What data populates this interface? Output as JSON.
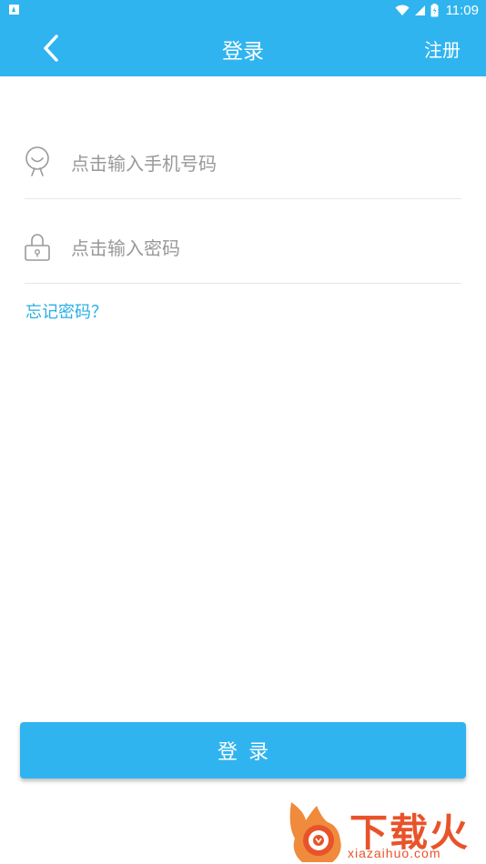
{
  "status_bar": {
    "time": "11:09",
    "icons": [
      "app-notification-icon",
      "wifi-icon",
      "signal-icon",
      "battery-icon"
    ]
  },
  "header": {
    "title": "登录",
    "back_icon": "chevron-left-icon",
    "register_label": "注册"
  },
  "form": {
    "phone": {
      "icon": "user-face-icon",
      "placeholder": "点击输入手机号码",
      "value": ""
    },
    "password": {
      "icon": "lock-icon",
      "placeholder": "点击输入密码",
      "value": ""
    },
    "forgot_label": "忘记密码？"
  },
  "login_button": {
    "label": "登录"
  },
  "watermark": {
    "text": "下载火",
    "url": "xiazaihuo.com"
  },
  "colors": {
    "primary": "#30b4ef",
    "link": "#2aaee5",
    "placeholder": "#999999",
    "divider": "#e6e6e6",
    "watermark": "#e8532a"
  }
}
